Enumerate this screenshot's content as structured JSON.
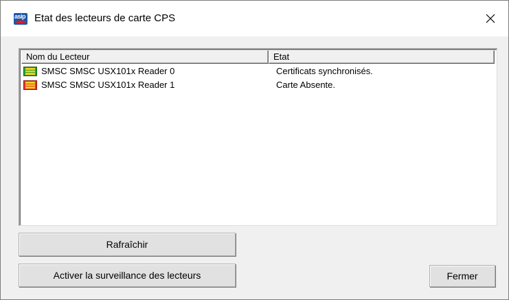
{
  "window": {
    "title": "Etat des lecteurs de carte CPS",
    "app_icon_text": "asip",
    "close_icon": "close-x-icon"
  },
  "listview": {
    "columns": [
      "Nom du Lecteur",
      "Etat"
    ],
    "rows": [
      {
        "name": "SMSC SMSC USX101x Reader  0",
        "state": "Certificats synchronisés.",
        "icon": "card-reader-green-icon",
        "icon_color": "#2e9e2e"
      },
      {
        "name": "SMSC SMSC USX101x Reader  1",
        "state": "Carte Absente.",
        "icon": "card-reader-red-icon",
        "icon_color": "#e5322b"
      }
    ]
  },
  "buttons": {
    "refresh": "Rafraîchir",
    "monitor": "Activer la surveillance des lecteurs",
    "close": "Fermer"
  }
}
